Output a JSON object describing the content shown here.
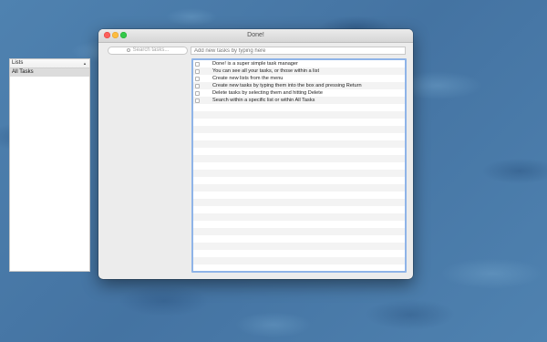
{
  "window": {
    "title": "Done!"
  },
  "search": {
    "placeholder": "Search tasks..."
  },
  "add_task": {
    "placeholder": "Add new tasks by typing here"
  },
  "sidebar": {
    "header": "Lists",
    "items": [
      {
        "label": "All Tasks",
        "selected": true
      }
    ]
  },
  "tasks": [
    {
      "text": "Done! is a super simple task manager",
      "done": false
    },
    {
      "text": "You can see all your tasks, or those within a list",
      "done": false
    },
    {
      "text": "Create new lists from the menu",
      "done": false
    },
    {
      "text": "Create new tasks by typing them into the box and pressing Return",
      "done": false
    },
    {
      "text": "Delete tasks by selecting them and hitting Delete",
      "done": false
    },
    {
      "text": "Search within a specific list or within All Tasks",
      "done": false
    }
  ],
  "colors": {
    "close": "#fc605c",
    "minimize": "#fdbc40",
    "maximize": "#34c84a",
    "focus_ring": "#8fb4e8"
  }
}
